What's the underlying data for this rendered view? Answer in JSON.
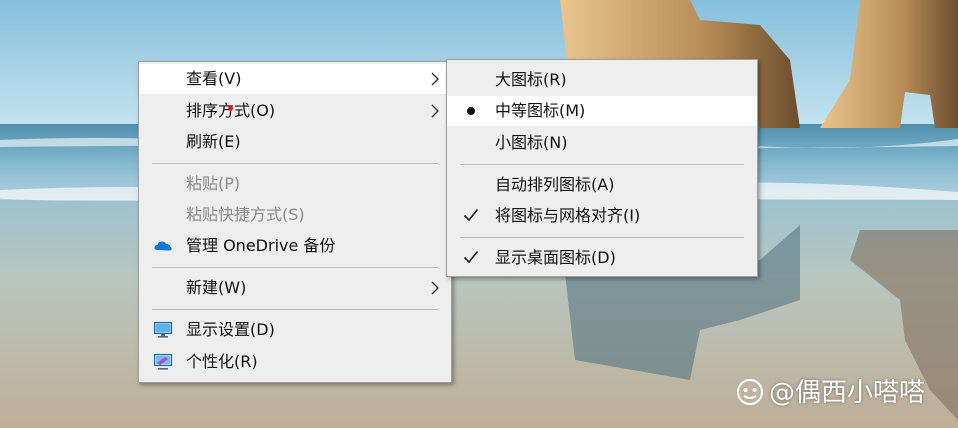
{
  "desktop": {
    "wallpaper": "beach-rock-arch"
  },
  "context_menu": {
    "items": [
      {
        "label": "查看(V)",
        "has_submenu": true,
        "highlighted": true
      },
      {
        "label": "排序方式(O)",
        "has_submenu": true
      },
      {
        "label": "刷新(E)"
      },
      {
        "label": "粘贴(P)",
        "disabled": true
      },
      {
        "label": "粘贴快捷方式(S)",
        "disabled": true
      },
      {
        "label": "管理 OneDrive 备份",
        "icon": "onedrive-cloud-icon"
      },
      {
        "label": "新建(W)",
        "has_submenu": true
      },
      {
        "label": "显示设置(D)",
        "icon": "display-settings-icon"
      },
      {
        "label": "个性化(R)",
        "icon": "personalize-icon"
      }
    ]
  },
  "view_submenu": {
    "items": [
      {
        "label": "大图标(R)"
      },
      {
        "label": "中等图标(M)",
        "selected": true,
        "mark": "bullet"
      },
      {
        "label": "小图标(N)"
      },
      {
        "label": "自动排列图标(A)"
      },
      {
        "label": "将图标与网格对齐(I)",
        "checked": true
      },
      {
        "label": "显示桌面图标(D)",
        "checked": true
      }
    ]
  },
  "watermark": {
    "text": "@偶西小嗒嗒"
  },
  "colors": {
    "menu_bg": "#eeeeee",
    "highlight": "#ffffff",
    "disabled_text": "#8a8a8a",
    "accent_dot": "#e0201b",
    "onedrive_blue": "#0f78d4"
  }
}
